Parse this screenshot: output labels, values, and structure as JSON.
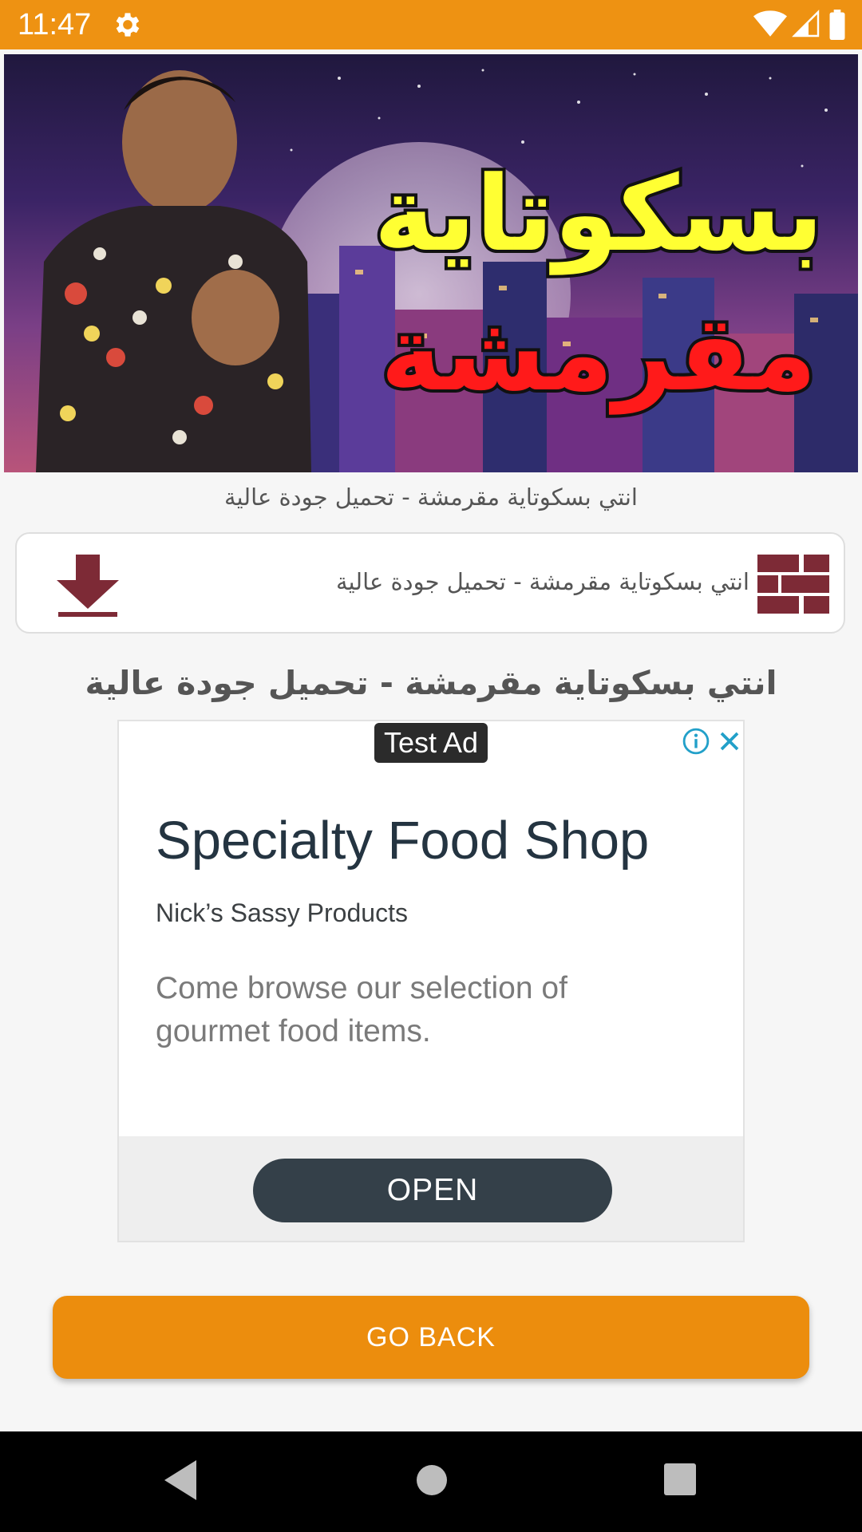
{
  "status_bar": {
    "time": "11:47",
    "icons": [
      "gear-icon",
      "wifi-icon",
      "signal-icon",
      "battery-icon"
    ]
  },
  "hero": {
    "banner_text_line1": "بسكوتاية",
    "banner_text_line2": "مقرمشة"
  },
  "caption": "انتي بسكوتاية مقرمشة - تحميل جودة عالية",
  "download_card": {
    "title": "انتي بسكوتاية مقرمشة - تحميل جودة عالية",
    "left_icon": "download-icon",
    "right_icon": "list-icon"
  },
  "main_title": "انتي بسكوتاية مقرمشة - تحميل جودة عالية",
  "ad": {
    "badge": "Test Ad",
    "headline": "Specialty Food Shop",
    "advertiser": "Nick’s Sassy Products",
    "body": "Come browse our selection of gourmet food items.",
    "cta": "OPEN"
  },
  "go_back_label": "GO BACK",
  "colors": {
    "accent": "#ee9212",
    "button": "#ec8d0d",
    "icon_maroon": "#7d2a36",
    "ad_button": "#344049"
  }
}
